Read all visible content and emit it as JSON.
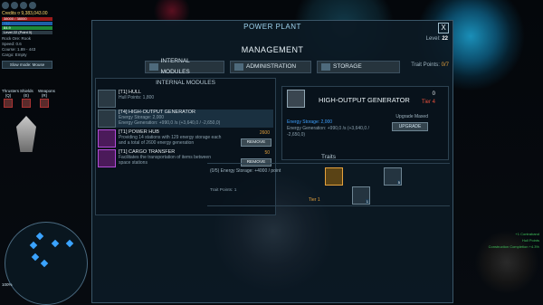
{
  "hud": {
    "credits": "Credits ¤ 9,383,043.00",
    "hull_bar": "38000 / 38000",
    "shield_bar": "+12",
    "power_bar": "84.9",
    "level_bar": "Level 22 (Point 0)",
    "stats": [
      "Rock Ore: Rook",
      "Speed: 0.6",
      "Course: 1.89 - 443",
      "Cargo: Empty"
    ],
    "mouse_btn": "Slow mode: Mouse",
    "thrusters": "Thrusters",
    "thrusters_key": "(Q)",
    "shields": "Shields",
    "shields_key": "(E)",
    "weapons": "Weapons",
    "weapons_key": "(R)",
    "zoom": "100%",
    "log": [
      "+1 Contraband",
      "Hull Points",
      "Construction Completion +4.3%"
    ]
  },
  "panel": {
    "title": "POWER PLANT",
    "close": "X",
    "level_label": "Level:",
    "level_value": "22",
    "management": "MANAGEMENT",
    "tabs": [
      "INTERNAL MODULES",
      "ADMINISTRATION",
      "STORAGE"
    ],
    "trait_points_label": "Trait Points:",
    "trait_points_value": "0/7"
  },
  "modules": {
    "heading": "INTERNAL MODULES",
    "items": [
      {
        "name": "[T1] HULL",
        "line1": "Hull Points: 1,800",
        "line2": ""
      },
      {
        "name": "[T4] HIGH-OUTPUT GENERATOR",
        "line1": "Energy Storage: 2,000",
        "line2": "Energy Generation: +990,0 /s (+3,640,0 / -2,650,0)"
      },
      {
        "name": "[T1] POWER HUB",
        "line1": "Providing 14 stations with 129 energy storage each",
        "line2": "and a total of 2600 energy generation",
        "cost": "2600",
        "remove": "REMOVE"
      },
      {
        "name": "[T1] CARGO TRANSFER",
        "line1": "Facilitates the transportation of items between",
        "line2": "space stations",
        "cost": "50",
        "remove": "REMOVE"
      }
    ]
  },
  "detail": {
    "title": "HIGH-OUTPUT GENERATOR",
    "count": "0",
    "tier": "Tier 4",
    "stat1": "Energy Storage: 2,000",
    "stat2": "Energy Generation: +990,0 /s (+3,640,0 / -2,650,0)",
    "upgrade_maxed": "Upgrade Maxed",
    "upgrade_btn": "UPGRADE"
  },
  "traits": {
    "heading": "Traits",
    "line": "(0/5) Energy Storage: +4000 / point",
    "points": "Trait Points: 1",
    "tier": "Tier 1",
    "badges": [
      "5",
      "1"
    ]
  },
  "colors": {
    "accent": "#3ea1ff",
    "gold": "#e6a23c",
    "tier": "#e6503c"
  }
}
